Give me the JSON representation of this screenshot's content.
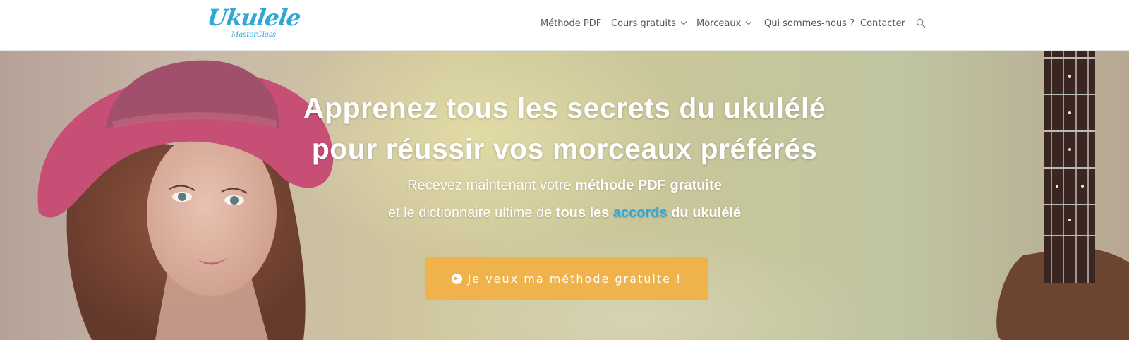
{
  "brand": {
    "logo_main": "Ukulele",
    "logo_sub": "MasterClass"
  },
  "nav": {
    "items": [
      {
        "label": "Méthode PDF"
      },
      {
        "label": "Cours gratuits"
      },
      {
        "label": "Morceaux"
      },
      {
        "label": "Qui sommes-nous ?"
      },
      {
        "label": "Contacter"
      }
    ]
  },
  "hero": {
    "title_line1": "Apprenez tous les secrets du ukulélé",
    "title_line2": "pour réussir vos morceaux préférés",
    "sub1_prefix": "Recevez maintenant votre ",
    "sub1_bold": "méthode PDF gratuite",
    "sub2_prefix": "et le dictionnaire ultime de ",
    "sub2_bold1": "tous les ",
    "sub2_accent": "accords",
    "sub2_bold2": " du ukulélé",
    "cta_label": "Je veux ma méthode gratuite !"
  },
  "colors": {
    "brand": "#2fa8d8",
    "accent": "#2aa9e0",
    "cta": "#f0b34c"
  },
  "icons": {
    "search": "search-icon",
    "cta": "arrow-circle-right-icon",
    "dropdown": "chevron-down-icon"
  }
}
